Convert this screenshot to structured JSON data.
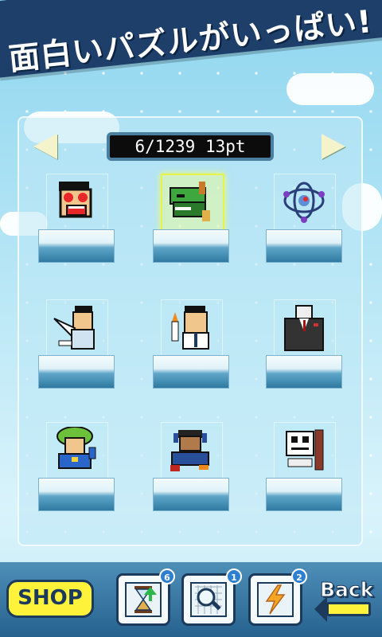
{
  "banner": {
    "title": "面白いパズルがいっぱい!"
  },
  "nav": {
    "prev_icon": "left-arrow-icon",
    "next_icon": "right-arrow-icon"
  },
  "counter": {
    "text": "6/1239 13pt"
  },
  "puzzles": [
    {
      "name": "heart-eyes-face",
      "selected": false
    },
    {
      "name": "green-dragon",
      "selected": true
    },
    {
      "name": "atom-molecule",
      "selected": false
    },
    {
      "name": "man-flying",
      "selected": false
    },
    {
      "name": "man-with-torch",
      "selected": false
    },
    {
      "name": "suited-man",
      "selected": false
    },
    {
      "name": "green-hair-dancer",
      "selected": false
    },
    {
      "name": "man-with-headphones",
      "selected": false
    },
    {
      "name": "robot-face",
      "selected": false
    }
  ],
  "toolbar": {
    "shop_label": "SHOP",
    "hourglass_count": "6",
    "magnifier_count": "1",
    "lightning_count": "2",
    "back_label": "Back"
  },
  "colors": {
    "accent": "#fff23b",
    "dark": "#1b3a5c",
    "badge": "#2c7fd1",
    "selected": "#e8f34a"
  }
}
